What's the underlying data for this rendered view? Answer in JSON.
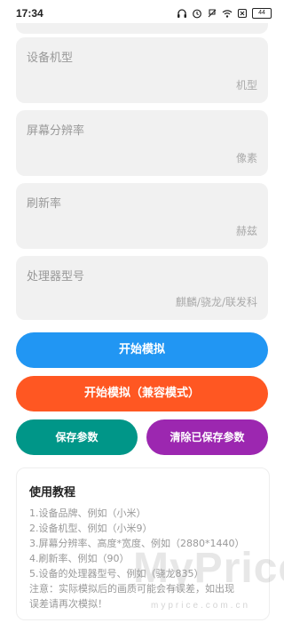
{
  "status_bar": {
    "time": "17:34",
    "battery": "44",
    "icons": [
      "headphones-icon",
      "alarm-icon",
      "do-not-disturb-icon",
      "wifi-icon",
      "close-box-icon"
    ]
  },
  "fields": [
    {
      "label": "设备机型",
      "placeholder": "机型"
    },
    {
      "label": "屏幕分辨率",
      "placeholder": "像素"
    },
    {
      "label": "刷新率",
      "placeholder": "赫兹"
    },
    {
      "label": "处理器型号",
      "placeholder": "麒麟/骁龙/联发科"
    }
  ],
  "buttons": {
    "start": "开始模拟",
    "start_compat": "开始模拟（兼容模式）",
    "save": "保存参数",
    "clear": "清除已保存参数"
  },
  "tutorial": {
    "title": "使用教程",
    "lines": [
      "1.设备品牌、例如（小米）",
      "2.设备机型、例如（小米9）",
      "3.屏幕分辨率、高度*宽度、例如（2880*1440）",
      "4.刷新率、例如（90）",
      "5.设备的处理器型号、例如（骁龙835）",
      "注意：实际模拟后的画质可能会有误差，如出现",
      "误差请再次模拟！"
    ]
  },
  "watermark": {
    "text": "MyPrice",
    "sub": "myprice.com.cn"
  },
  "colors": {
    "start": "#2196f3",
    "start_compat": "#ff5722",
    "save": "#009688",
    "clear": "#9c27b0",
    "card_bg": "#f1f1f1"
  }
}
